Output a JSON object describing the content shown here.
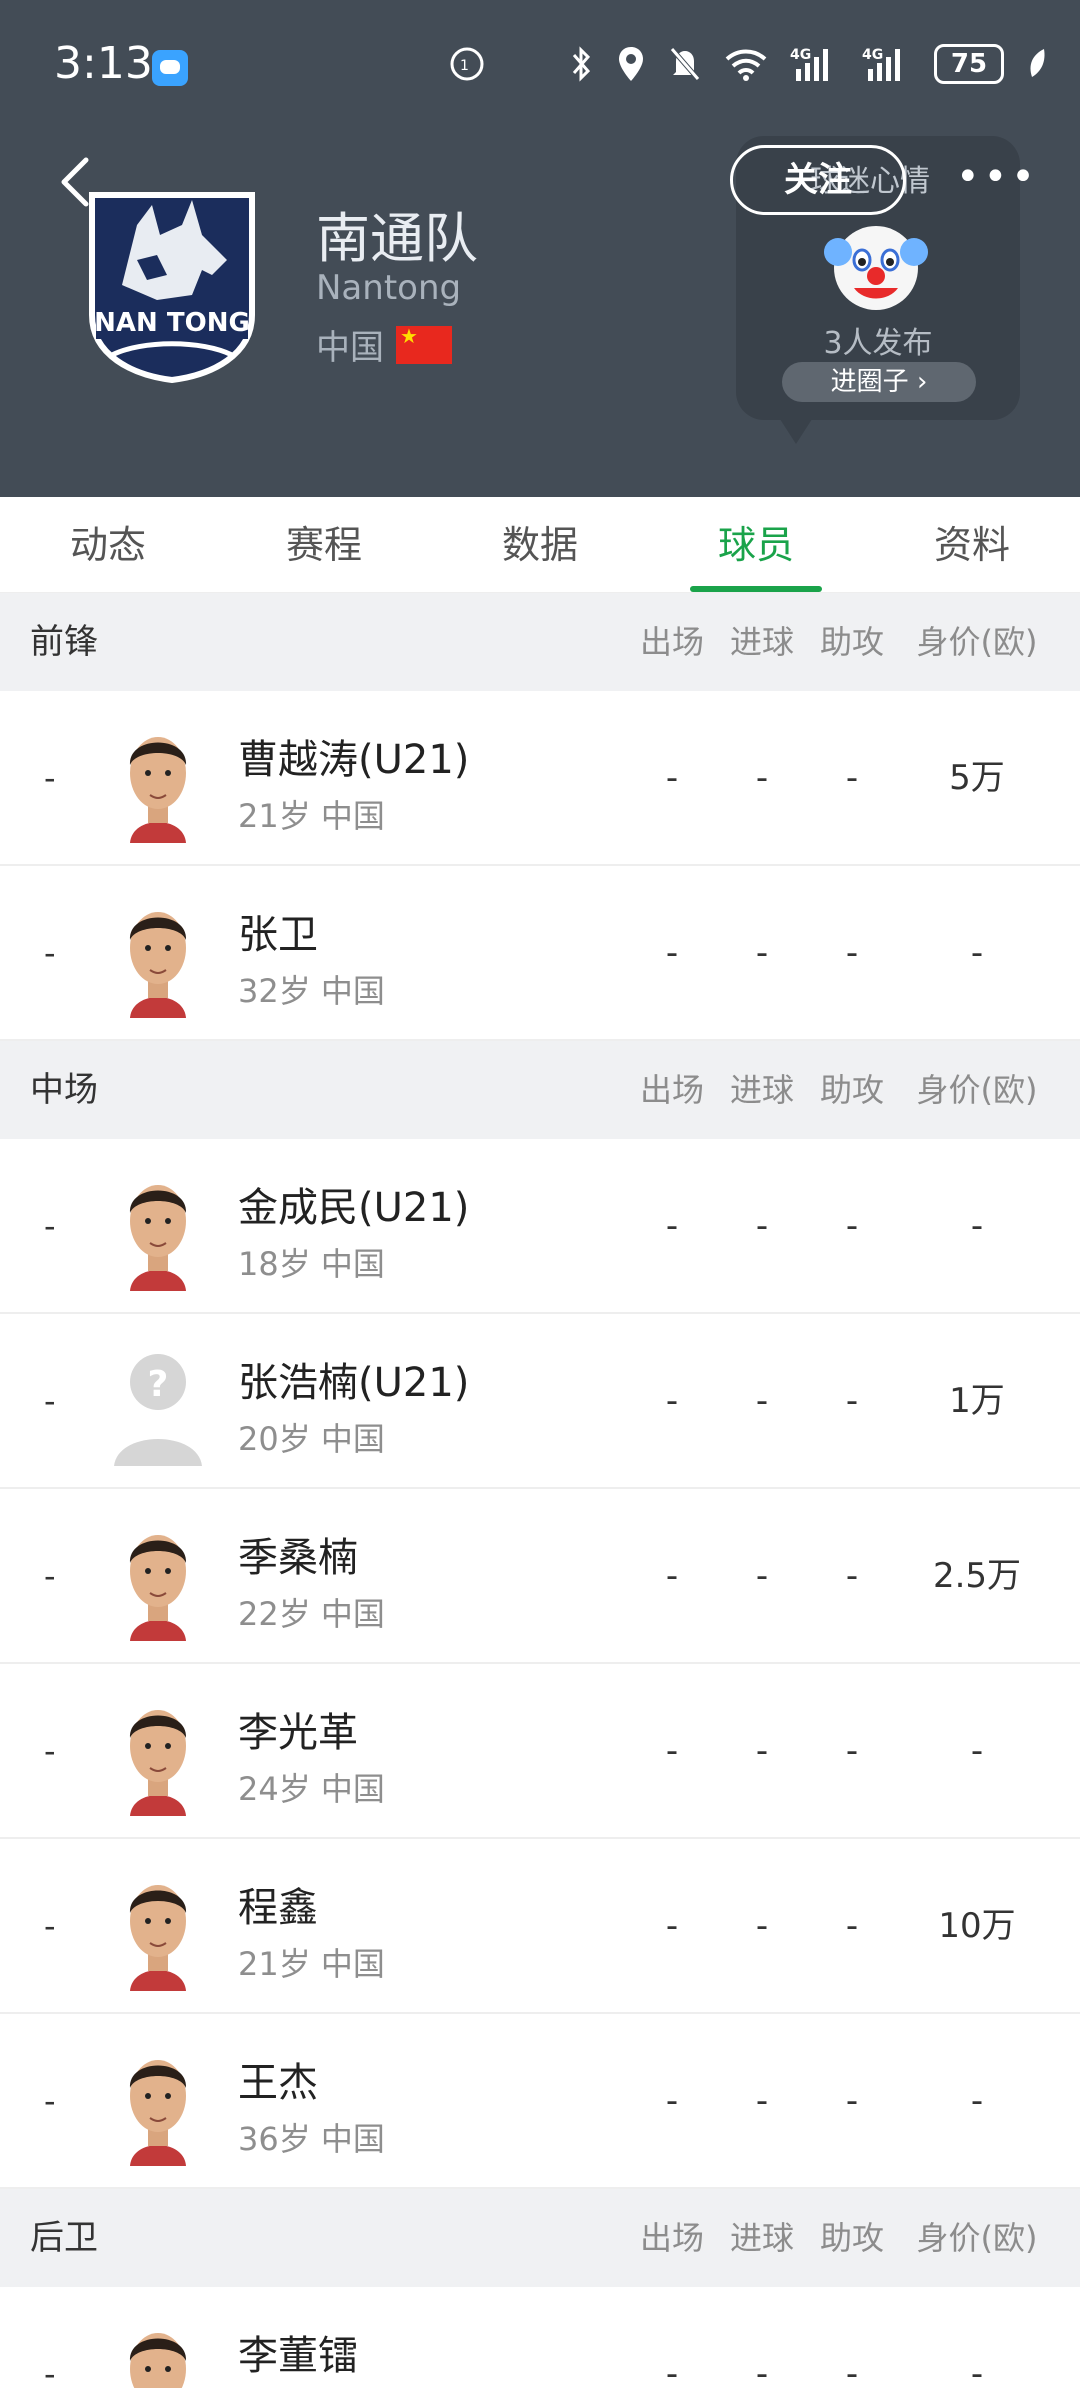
{
  "status": {
    "time": "3:13",
    "battery": "75",
    "icons": [
      "chat-app-icon",
      "hd-call-icon",
      "bluetooth-icon",
      "location-icon",
      "mute-icon",
      "wifi-icon",
      "signal-4g-icon",
      "signal-4g-icon",
      "leaf-icon"
    ]
  },
  "team": {
    "name": "南通队",
    "name_en": "Nantong",
    "country": "中国",
    "logo_text": "NAN TONG"
  },
  "header": {
    "follow_label": "关注",
    "circle_label": "球迷心情",
    "circle_count": "3人发布",
    "circle_enter": "进圈子"
  },
  "tabs": [
    {
      "label": "动态"
    },
    {
      "label": "赛程"
    },
    {
      "label": "数据"
    },
    {
      "label": "球员"
    },
    {
      "label": "资料"
    }
  ],
  "columns": [
    "出场",
    "进球",
    "助攻",
    "身价(欧)"
  ],
  "sections": [
    {
      "title": "前锋",
      "players": [
        {
          "num": "-",
          "name": "曹越涛(U21)",
          "meta": "21岁 中国",
          "apps": "-",
          "goals": "-",
          "assists": "-",
          "value": "5万",
          "avatar": "photo"
        },
        {
          "num": "-",
          "name": "张卫",
          "meta": "32岁 中国",
          "apps": "-",
          "goals": "-",
          "assists": "-",
          "value": "-",
          "avatar": "photo"
        }
      ]
    },
    {
      "title": "中场",
      "players": [
        {
          "num": "-",
          "name": "金成民(U21)",
          "meta": "18岁 中国",
          "apps": "-",
          "goals": "-",
          "assists": "-",
          "value": "-",
          "avatar": "photo"
        },
        {
          "num": "-",
          "name": "张浩楠(U21)",
          "meta": "20岁 中国",
          "apps": "-",
          "goals": "-",
          "assists": "-",
          "value": "1万",
          "avatar": "placeholder"
        },
        {
          "num": "-",
          "name": "季桑楠",
          "meta": "22岁 中国",
          "apps": "-",
          "goals": "-",
          "assists": "-",
          "value": "2.5万",
          "avatar": "photo"
        },
        {
          "num": "-",
          "name": "李光革",
          "meta": "24岁 中国",
          "apps": "-",
          "goals": "-",
          "assists": "-",
          "value": "-",
          "avatar": "photo"
        },
        {
          "num": "-",
          "name": "程鑫",
          "meta": "21岁 中国",
          "apps": "-",
          "goals": "-",
          "assists": "-",
          "value": "10万",
          "avatar": "photo"
        },
        {
          "num": "-",
          "name": "王杰",
          "meta": "36岁 中国",
          "apps": "-",
          "goals": "-",
          "assists": "-",
          "value": "-",
          "avatar": "photo"
        }
      ]
    },
    {
      "title": "后卫",
      "players": [
        {
          "num": "-",
          "name": "李董镭",
          "meta": "",
          "apps": "-",
          "goals": "-",
          "assists": "-",
          "value": "-",
          "avatar": "photo"
        }
      ]
    }
  ],
  "colors": {
    "header_bg": "#434c56",
    "accent": "#1aa34a",
    "section_bg": "#f0f1f3"
  }
}
